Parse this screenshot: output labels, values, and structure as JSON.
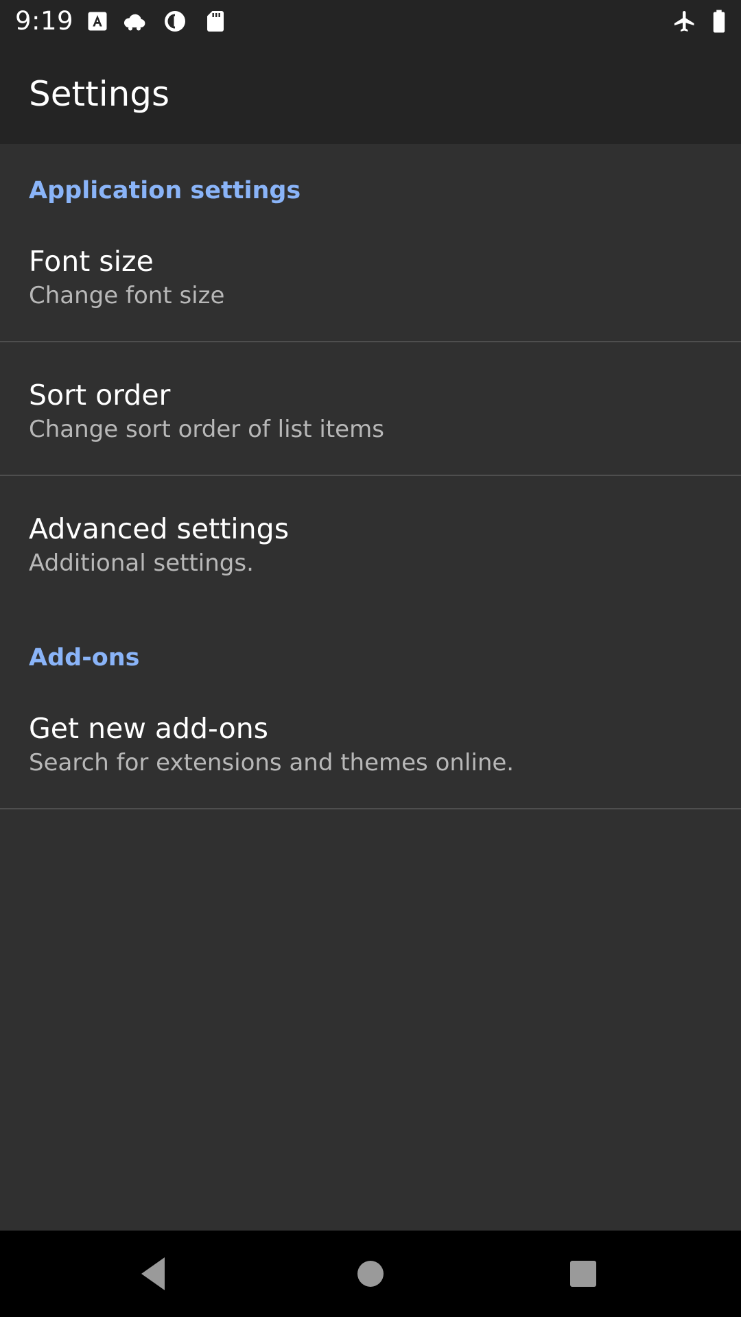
{
  "status_bar": {
    "time": "9:19",
    "left_icons": [
      "font-a-icon",
      "cloud-icon",
      "sync-icon",
      "sd-card-icon"
    ],
    "right_icons": [
      "airplane-icon",
      "battery-icon"
    ]
  },
  "app_bar": {
    "title": "Settings"
  },
  "sections": [
    {
      "header": "Application settings",
      "items": [
        {
          "title": "Font size",
          "summary": "Change font size"
        },
        {
          "title": "Sort order",
          "summary": "Change sort order of list items"
        },
        {
          "title": "Advanced settings",
          "summary": "Additional settings."
        }
      ]
    },
    {
      "header": "Add-ons",
      "items": [
        {
          "title": "Get new add-ons",
          "summary": "Search for extensions and themes online."
        }
      ]
    }
  ],
  "nav_bar": {
    "buttons": [
      "back-icon",
      "home-icon",
      "recents-icon"
    ]
  },
  "colors": {
    "accent": "#8ab4f8",
    "background": "#303030",
    "toolbar": "#242424",
    "nav_bar": "#000000"
  }
}
